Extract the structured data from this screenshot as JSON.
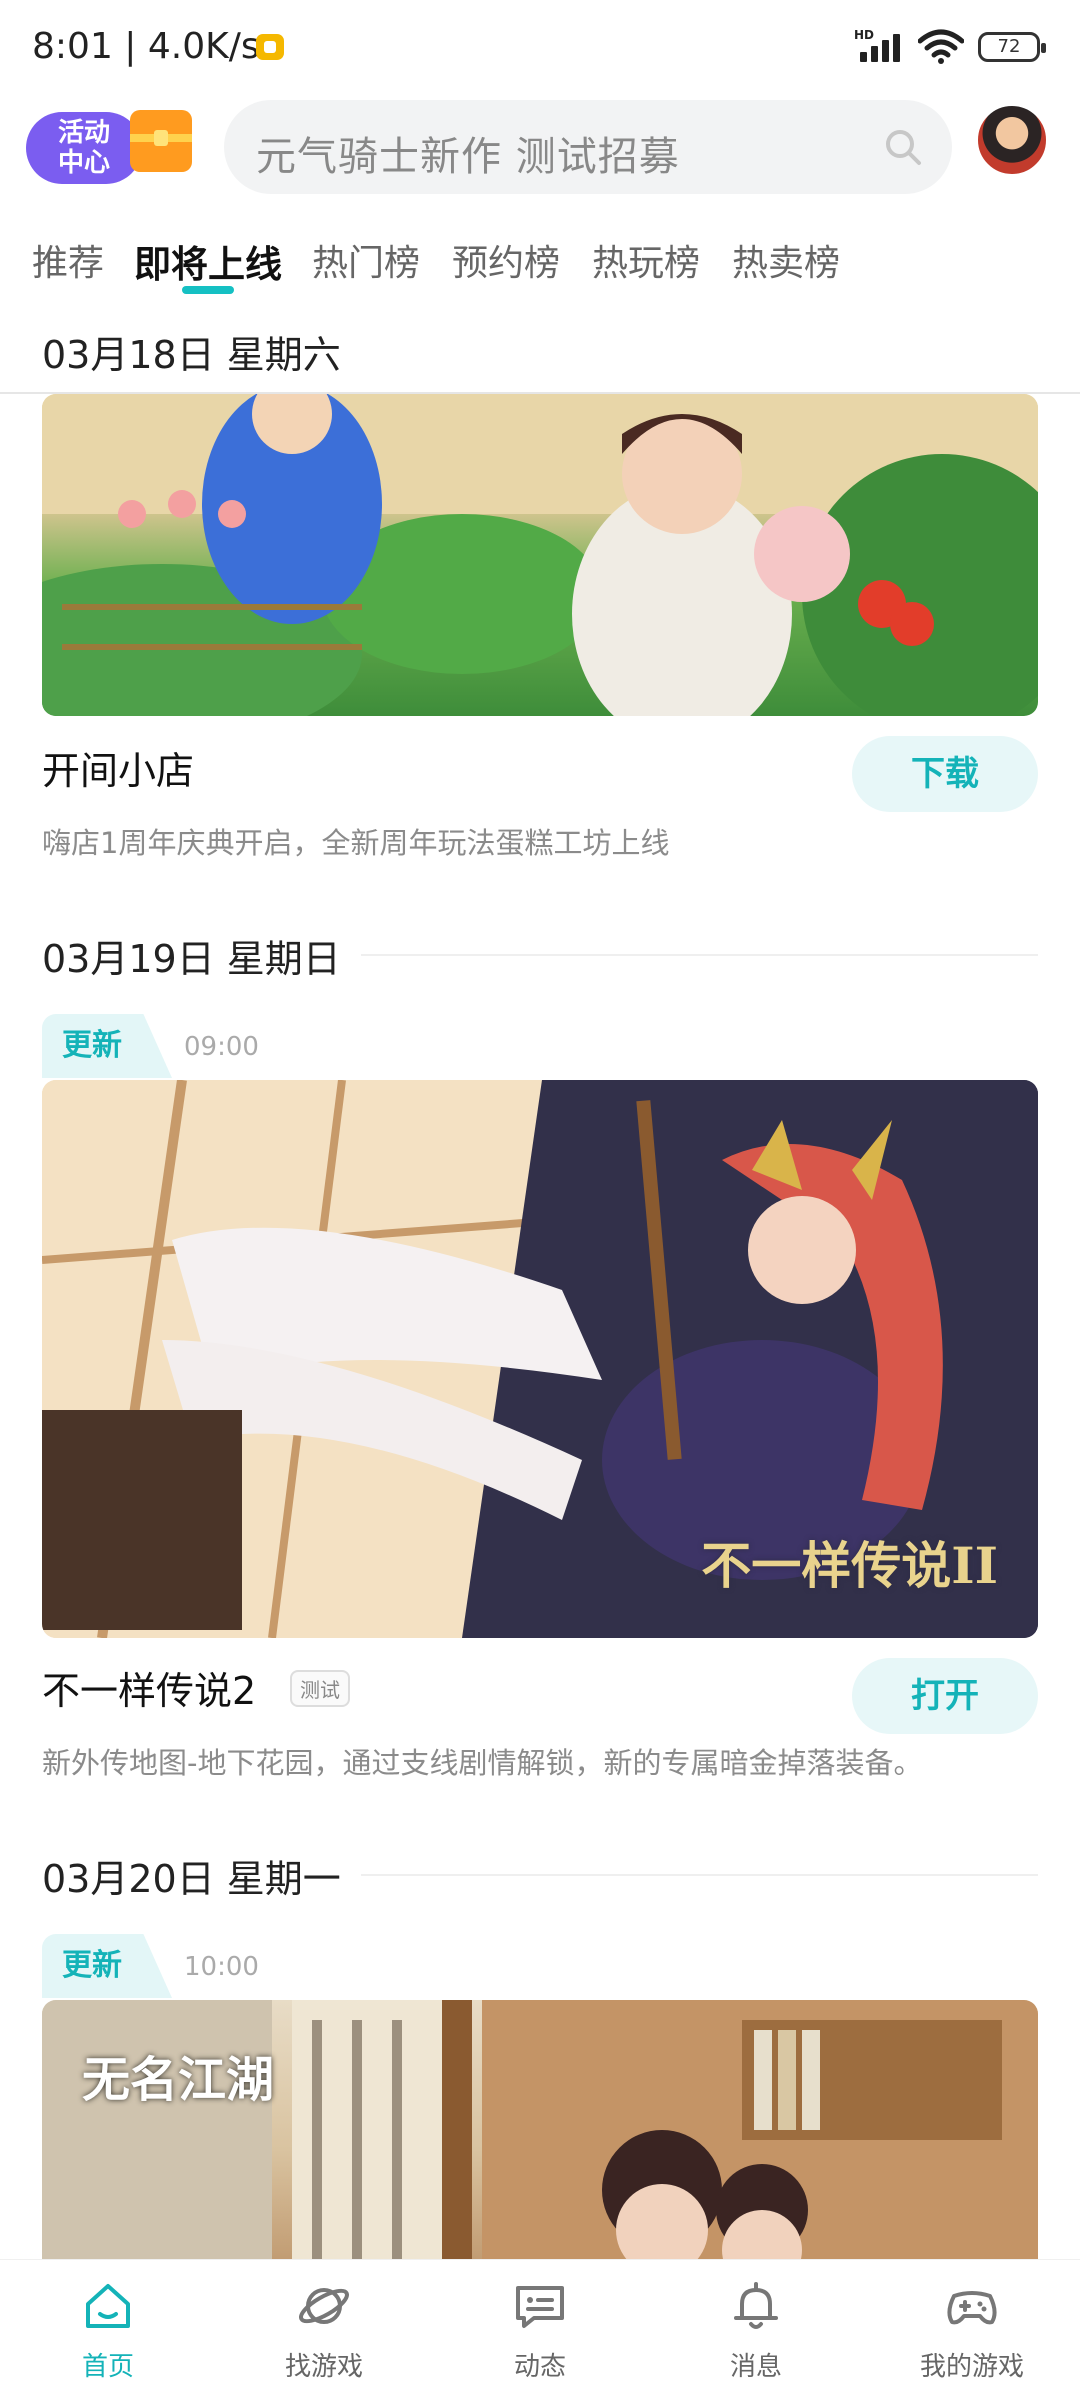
{
  "status_bar": {
    "time": "8:01 | 4.0K/s",
    "network_label": "HD",
    "battery": "72"
  },
  "header": {
    "activity_center_label_line1": "活动",
    "activity_center_label_line2": "中心",
    "search_placeholder": "元气骑士新作 测试招募"
  },
  "tabs": [
    "推荐",
    "即将上线",
    "热门榜",
    "预约榜",
    "热玩榜",
    "热卖榜"
  ],
  "active_tab": "即将上线",
  "sticky_date": "03月18日 星期六",
  "sections": [
    {
      "title": "开间小店",
      "description": "嗨店1周年庆典开启，全新周年玩法蛋糕工坊上线",
      "button": "下载"
    },
    {
      "date": "03月19日 星期日",
      "tag": "更新",
      "time": "09:00",
      "title": "不一样传说2",
      "badge": "测试",
      "description": "新外传地图-地下花园，通过支线剧情解锁，新的专属暗金掉落装备。",
      "button": "打开",
      "image_logo_text": "不一样传说II"
    },
    {
      "date": "03月20日 星期一",
      "tag": "更新",
      "time": "10:00",
      "image_logo_text": "无名江湖"
    }
  ],
  "bottom_nav": [
    {
      "label": "首页",
      "icon": "home-icon"
    },
    {
      "label": "找游戏",
      "icon": "planet-icon"
    },
    {
      "label": "动态",
      "icon": "message-icon"
    },
    {
      "label": "消息",
      "icon": "bell-icon"
    },
    {
      "label": "我的游戏",
      "icon": "gamepad-icon"
    }
  ],
  "colors": {
    "accent": "#14b3b8",
    "tag_bg": "#e3f6f7"
  }
}
